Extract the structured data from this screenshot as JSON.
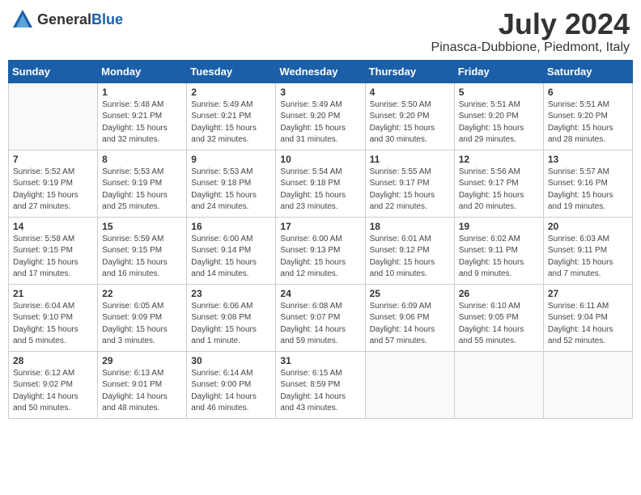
{
  "header": {
    "logo": {
      "general": "General",
      "blue": "Blue"
    },
    "title": "July 2024",
    "location": "Pinasca-Dubbione, Piedmont, Italy"
  },
  "columns": [
    "Sunday",
    "Monday",
    "Tuesday",
    "Wednesday",
    "Thursday",
    "Friday",
    "Saturday"
  ],
  "weeks": [
    [
      {
        "day": "",
        "info": ""
      },
      {
        "day": "1",
        "info": "Sunrise: 5:48 AM\nSunset: 9:21 PM\nDaylight: 15 hours\nand 32 minutes."
      },
      {
        "day": "2",
        "info": "Sunrise: 5:49 AM\nSunset: 9:21 PM\nDaylight: 15 hours\nand 32 minutes."
      },
      {
        "day": "3",
        "info": "Sunrise: 5:49 AM\nSunset: 9:20 PM\nDaylight: 15 hours\nand 31 minutes."
      },
      {
        "day": "4",
        "info": "Sunrise: 5:50 AM\nSunset: 9:20 PM\nDaylight: 15 hours\nand 30 minutes."
      },
      {
        "day": "5",
        "info": "Sunrise: 5:51 AM\nSunset: 9:20 PM\nDaylight: 15 hours\nand 29 minutes."
      },
      {
        "day": "6",
        "info": "Sunrise: 5:51 AM\nSunset: 9:20 PM\nDaylight: 15 hours\nand 28 minutes."
      }
    ],
    [
      {
        "day": "7",
        "info": "Sunrise: 5:52 AM\nSunset: 9:19 PM\nDaylight: 15 hours\nand 27 minutes."
      },
      {
        "day": "8",
        "info": "Sunrise: 5:53 AM\nSunset: 9:19 PM\nDaylight: 15 hours\nand 25 minutes."
      },
      {
        "day": "9",
        "info": "Sunrise: 5:53 AM\nSunset: 9:18 PM\nDaylight: 15 hours\nand 24 minutes."
      },
      {
        "day": "10",
        "info": "Sunrise: 5:54 AM\nSunset: 9:18 PM\nDaylight: 15 hours\nand 23 minutes."
      },
      {
        "day": "11",
        "info": "Sunrise: 5:55 AM\nSunset: 9:17 PM\nDaylight: 15 hours\nand 22 minutes."
      },
      {
        "day": "12",
        "info": "Sunrise: 5:56 AM\nSunset: 9:17 PM\nDaylight: 15 hours\nand 20 minutes."
      },
      {
        "day": "13",
        "info": "Sunrise: 5:57 AM\nSunset: 9:16 PM\nDaylight: 15 hours\nand 19 minutes."
      }
    ],
    [
      {
        "day": "14",
        "info": "Sunrise: 5:58 AM\nSunset: 9:15 PM\nDaylight: 15 hours\nand 17 minutes."
      },
      {
        "day": "15",
        "info": "Sunrise: 5:59 AM\nSunset: 9:15 PM\nDaylight: 15 hours\nand 16 minutes."
      },
      {
        "day": "16",
        "info": "Sunrise: 6:00 AM\nSunset: 9:14 PM\nDaylight: 15 hours\nand 14 minutes."
      },
      {
        "day": "17",
        "info": "Sunrise: 6:00 AM\nSunset: 9:13 PM\nDaylight: 15 hours\nand 12 minutes."
      },
      {
        "day": "18",
        "info": "Sunrise: 6:01 AM\nSunset: 9:12 PM\nDaylight: 15 hours\nand 10 minutes."
      },
      {
        "day": "19",
        "info": "Sunrise: 6:02 AM\nSunset: 9:11 PM\nDaylight: 15 hours\nand 9 minutes."
      },
      {
        "day": "20",
        "info": "Sunrise: 6:03 AM\nSunset: 9:11 PM\nDaylight: 15 hours\nand 7 minutes."
      }
    ],
    [
      {
        "day": "21",
        "info": "Sunrise: 6:04 AM\nSunset: 9:10 PM\nDaylight: 15 hours\nand 5 minutes."
      },
      {
        "day": "22",
        "info": "Sunrise: 6:05 AM\nSunset: 9:09 PM\nDaylight: 15 hours\nand 3 minutes."
      },
      {
        "day": "23",
        "info": "Sunrise: 6:06 AM\nSunset: 9:08 PM\nDaylight: 15 hours\nand 1 minute."
      },
      {
        "day": "24",
        "info": "Sunrise: 6:08 AM\nSunset: 9:07 PM\nDaylight: 14 hours\nand 59 minutes."
      },
      {
        "day": "25",
        "info": "Sunrise: 6:09 AM\nSunset: 9:06 PM\nDaylight: 14 hours\nand 57 minutes."
      },
      {
        "day": "26",
        "info": "Sunrise: 6:10 AM\nSunset: 9:05 PM\nDaylight: 14 hours\nand 55 minutes."
      },
      {
        "day": "27",
        "info": "Sunrise: 6:11 AM\nSunset: 9:04 PM\nDaylight: 14 hours\nand 52 minutes."
      }
    ],
    [
      {
        "day": "28",
        "info": "Sunrise: 6:12 AM\nSunset: 9:02 PM\nDaylight: 14 hours\nand 50 minutes."
      },
      {
        "day": "29",
        "info": "Sunrise: 6:13 AM\nSunset: 9:01 PM\nDaylight: 14 hours\nand 48 minutes."
      },
      {
        "day": "30",
        "info": "Sunrise: 6:14 AM\nSunset: 9:00 PM\nDaylight: 14 hours\nand 46 minutes."
      },
      {
        "day": "31",
        "info": "Sunrise: 6:15 AM\nSunset: 8:59 PM\nDaylight: 14 hours\nand 43 minutes."
      },
      {
        "day": "",
        "info": ""
      },
      {
        "day": "",
        "info": ""
      },
      {
        "day": "",
        "info": ""
      }
    ]
  ]
}
